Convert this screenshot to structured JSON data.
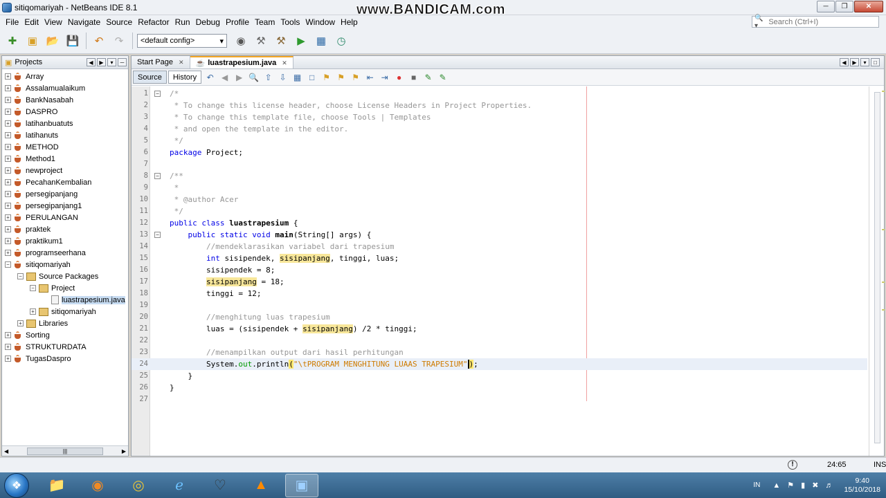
{
  "window": {
    "title": "sitiqomariyah - NetBeans IDE 8.1",
    "watermark": "www.BANDICAM.com"
  },
  "menu": [
    "File",
    "Edit",
    "View",
    "Navigate",
    "Source",
    "Refactor",
    "Run",
    "Debug",
    "Profile",
    "Team",
    "Tools",
    "Window",
    "Help"
  ],
  "search": {
    "placeholder": "Search (Ctrl+I)"
  },
  "toolbar": {
    "config": "<default config>"
  },
  "projects_panel": {
    "title": "Projects",
    "items": [
      {
        "label": "Array",
        "level": 0,
        "type": "project",
        "expander": "+"
      },
      {
        "label": "Assalamualaikum",
        "level": 0,
        "type": "project",
        "expander": "+"
      },
      {
        "label": "BankNasabah",
        "level": 0,
        "type": "project",
        "expander": "+"
      },
      {
        "label": "DASPRO",
        "level": 0,
        "type": "project",
        "expander": "+"
      },
      {
        "label": "latihanbuatuts",
        "level": 0,
        "type": "project",
        "expander": "+"
      },
      {
        "label": "latihanuts",
        "level": 0,
        "type": "project",
        "expander": "+"
      },
      {
        "label": "METHOD",
        "level": 0,
        "type": "project",
        "expander": "+"
      },
      {
        "label": "Method1",
        "level": 0,
        "type": "project",
        "expander": "+"
      },
      {
        "label": "newproject",
        "level": 0,
        "type": "project",
        "expander": "+"
      },
      {
        "label": "PecahanKembalian",
        "level": 0,
        "type": "project",
        "expander": "+"
      },
      {
        "label": "persegipanjang",
        "level": 0,
        "type": "project",
        "expander": "+"
      },
      {
        "label": "persegipanjang1",
        "level": 0,
        "type": "project",
        "expander": "+"
      },
      {
        "label": "PERULANGAN",
        "level": 0,
        "type": "project",
        "expander": "+"
      },
      {
        "label": "praktek",
        "level": 0,
        "type": "project",
        "expander": "+"
      },
      {
        "label": "praktikum1",
        "level": 0,
        "type": "project",
        "expander": "+"
      },
      {
        "label": "programseerhana",
        "level": 0,
        "type": "project",
        "expander": "+"
      },
      {
        "label": "sitiqomariyah",
        "level": 0,
        "type": "project",
        "expander": "-"
      },
      {
        "label": "Source Packages",
        "level": 1,
        "type": "package",
        "expander": "-"
      },
      {
        "label": "Project",
        "level": 2,
        "type": "package",
        "expander": "-"
      },
      {
        "label": "luastrapesium.java",
        "level": 3,
        "type": "file",
        "expander": "",
        "selected": true
      },
      {
        "label": "sitiqomariyah",
        "level": 2,
        "type": "package",
        "expander": "+"
      },
      {
        "label": "Libraries",
        "level": 1,
        "type": "package",
        "expander": "+"
      },
      {
        "label": "Sorting",
        "level": 0,
        "type": "project",
        "expander": "+"
      },
      {
        "label": "STRUKTURDATA",
        "level": 0,
        "type": "project",
        "expander": "+"
      },
      {
        "label": "TugasDaspro",
        "level": 0,
        "type": "project",
        "expander": "+"
      }
    ]
  },
  "editor": {
    "tabs": [
      {
        "label": "Start Page",
        "active": false
      },
      {
        "label": "luastrapesium.java",
        "active": true
      }
    ],
    "view_tabs": [
      {
        "label": "Source",
        "active": true
      },
      {
        "label": "History",
        "active": false
      }
    ],
    "lines": [
      {
        "n": "1",
        "fold": "-",
        "html": "<span class='cm'>/*</span>"
      },
      {
        "n": "2",
        "html": "<span class='cm'> * To change this license header, choose License Headers in Project Properties.</span>"
      },
      {
        "n": "3",
        "html": "<span class='cm'> * To change this template file, choose Tools | Templates</span>"
      },
      {
        "n": "4",
        "html": "<span class='cm'> * and open the template in the editor.</span>"
      },
      {
        "n": "5",
        "html": "<span class='cm'> */</span>"
      },
      {
        "n": "6",
        "html": "<span class='kw'>package</span> Project;"
      },
      {
        "n": "7",
        "html": ""
      },
      {
        "n": "8",
        "fold": "-",
        "html": "<span class='cm'>/**</span>"
      },
      {
        "n": "9",
        "html": "<span class='cm'> *</span>"
      },
      {
        "n": "10",
        "html": "<span class='cm'> * @author Acer</span>"
      },
      {
        "n": "11",
        "html": "<span class='cm'> */</span>"
      },
      {
        "n": "12",
        "html": "<span class='kw'>public class</span> <b>luastrapesium</b> {"
      },
      {
        "n": "13",
        "fold": "-",
        "html": "    <span class='kw'>public static void</span> <b>main</b>(String[] args) {"
      },
      {
        "n": "14",
        "html": "        <span class='cm'>//mendeklarasikan variabel dari trapesium</span>"
      },
      {
        "n": "15",
        "html": "        <span class='kw'>int</span> sisipendek, <span class='hl'>sisipanjang</span>, tinggi, luas;"
      },
      {
        "n": "16",
        "html": "        sisipendek = 8;"
      },
      {
        "n": "17",
        "html": "        <span class='hl'>sisipanjang</span> = 18;"
      },
      {
        "n": "18",
        "html": "        tinggi = 12;"
      },
      {
        "n": "19",
        "html": ""
      },
      {
        "n": "20",
        "html": "        <span class='cm'>//menghitung luas trapesium</span>"
      },
      {
        "n": "21",
        "html": "        luas = (sisipendek + <span class='hl'>sisipanjang</span>) /2 * tinggi;"
      },
      {
        "n": "22",
        "html": ""
      },
      {
        "n": "23",
        "html": "        <span class='cm'>//menampilkan output dari hasil perhitungan</span>"
      },
      {
        "n": "24",
        "current": true,
        "html": "        System.<span class='fld'>out</span>.println<span class='brace-match'>(</span><span class='str'>\"\\tPROGRAM MENGHITUNG LUAAS TRAPESIUM\"</span><span class='caret brace-match'>)</span>;"
      },
      {
        "n": "25",
        "html": "    }"
      },
      {
        "n": "26",
        "html": "}"
      },
      {
        "n": "27",
        "html": ""
      }
    ]
  },
  "status": {
    "position": "24:65",
    "mode": "INS",
    "notifications_icon": "!"
  },
  "taskbar": {
    "apps": [
      "folder-icon",
      "firefox-icon",
      "chrome-icon",
      "ie-icon",
      "dino-icon",
      "vlc-icon",
      "netbeans-icon"
    ],
    "tray_lang": "IN",
    "time": "9:40",
    "date": "15/10/2018"
  }
}
